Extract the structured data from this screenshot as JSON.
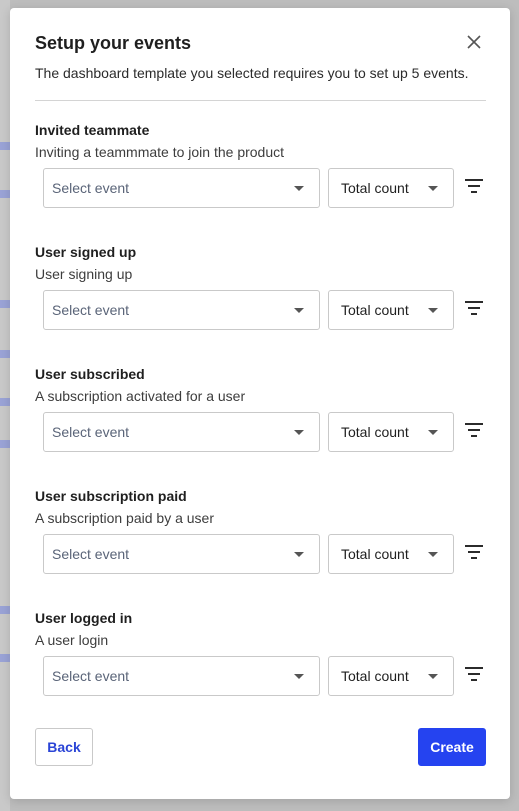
{
  "modal": {
    "title": "Setup your events",
    "subtitle": "The dashboard template you selected requires you to set up 5 events."
  },
  "events": [
    {
      "name": "Invited teammate",
      "description": "Inviting a teammmate to join the product",
      "event_placeholder": "Select event",
      "aggregation": "Total count"
    },
    {
      "name": "User signed up",
      "description": "User signing up",
      "event_placeholder": "Select event",
      "aggregation": "Total count"
    },
    {
      "name": "User subscribed",
      "description": "A subscription activated for a user",
      "event_placeholder": "Select event",
      "aggregation": "Total count"
    },
    {
      "name": "User subscription paid",
      "description": "A subscription paid by a user",
      "event_placeholder": "Select event",
      "aggregation": "Total count"
    },
    {
      "name": "User logged in",
      "description": "A user login",
      "event_placeholder": "Select event",
      "aggregation": "Total count"
    }
  ],
  "footer": {
    "back_label": "Back",
    "create_label": "Create"
  },
  "colors": {
    "primary": "#2543f0",
    "link": "#2a44d6",
    "backdrop": "#bdbdbd"
  }
}
